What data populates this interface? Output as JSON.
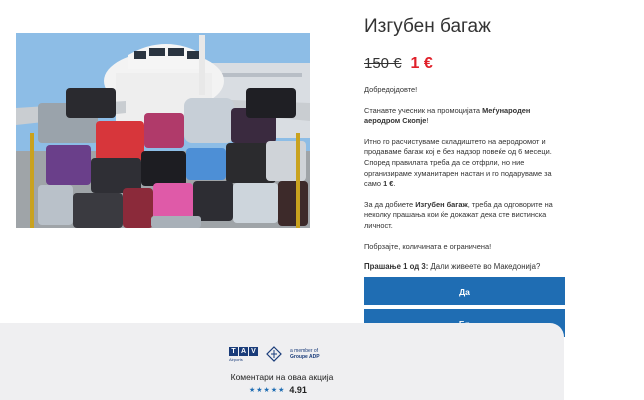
{
  "product": {
    "title": "Изгубен багаж",
    "old_price": "150 €",
    "new_price": "1 €"
  },
  "description": {
    "greeting": "Добредојдовте!",
    "p1_prefix": "Станавте учесник на промоцијата ",
    "p1_bold": "Меѓународен аеродром Скопје",
    "p1_suffix": "!",
    "p2_prefix": "Итно го расчистуваме складиштето на аеродромот и продаваме багаж кој е без надзор повеќе од 6 месеци. Според правилата треба да се отфрли, но ние организираме хуманитарен настан и го подаруваме за само ",
    "p2_bold": "1 €",
    "p2_suffix": ".",
    "p3_prefix": "За да добиете ",
    "p3_bold": "Изгубен багаж",
    "p3_suffix": ", треба да одговорите на неколку прашања кои ќе докажат дека сте вистинска личност.",
    "p4": "Побрзајте, количината е ограничена!"
  },
  "quiz": {
    "question_label": "Прашање 1 од 3:",
    "question_text": " Дали живеете во Македонија?",
    "answers": [
      "Да",
      "Бр"
    ]
  },
  "footer": {
    "tav_letters": [
      "T",
      "A",
      "V"
    ],
    "tav_sub": "Airports",
    "adp_line1": "a member of",
    "adp_line2": "Groupe ADP",
    "comments_label": "Коментари на оваа акција",
    "stars": "★★★★★",
    "rating": "4.91"
  },
  "colors": {
    "accent": "#1f6db3",
    "price_red": "#e0202a",
    "footer_bg": "#efeff1"
  }
}
